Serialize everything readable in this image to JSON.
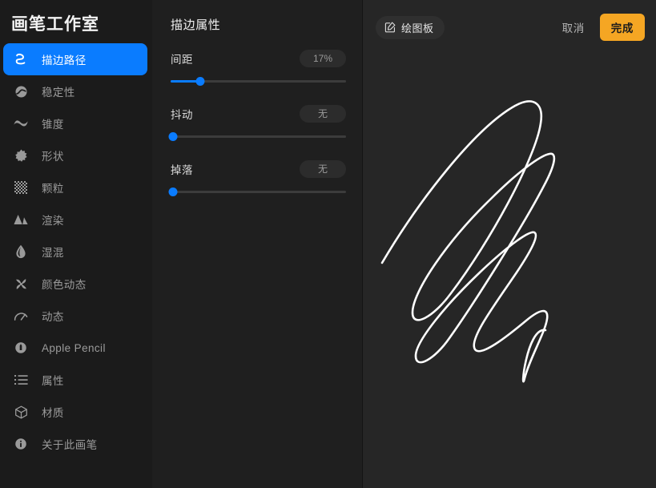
{
  "app": {
    "title": "画笔工作室"
  },
  "sidebar": {
    "items": [
      {
        "label": "描边路径",
        "icon": "stroke-path-icon",
        "selected": true
      },
      {
        "label": "稳定性",
        "icon": "stabilization-icon",
        "selected": false
      },
      {
        "label": "锥度",
        "icon": "taper-wave-icon",
        "selected": false
      },
      {
        "label": "形状",
        "icon": "shape-star-icon",
        "selected": false
      },
      {
        "label": "颗粒",
        "icon": "grain-dots-icon",
        "selected": false
      },
      {
        "label": "渲染",
        "icon": "render-mountains-icon",
        "selected": false
      },
      {
        "label": "湿混",
        "icon": "wet-mix-droplet-icon",
        "selected": false
      },
      {
        "label": "颜色动态",
        "icon": "color-dynamics-pinwheel-icon",
        "selected": false
      },
      {
        "label": "动态",
        "icon": "dynamics-gauge-icon",
        "selected": false
      },
      {
        "label": "Apple Pencil",
        "icon": "apple-pencil-icon",
        "selected": false
      },
      {
        "label": "属性",
        "icon": "properties-list-icon",
        "selected": false
      },
      {
        "label": "材质",
        "icon": "material-cube-icon",
        "selected": false
      },
      {
        "label": "关于此画笔",
        "icon": "info-circle-icon",
        "selected": false
      }
    ]
  },
  "properties": {
    "title": "描边属性",
    "sliders": [
      {
        "label": "间距",
        "value": "17%",
        "percent": 17
      },
      {
        "label": "抖动",
        "value": "无",
        "percent": 0
      },
      {
        "label": "掉落",
        "value": "无",
        "percent": 0
      }
    ]
  },
  "canvas": {
    "board_button": {
      "label": "绘图板",
      "icon": "compose-square-pencil-icon"
    },
    "cancel_label": "取消",
    "done_label": "完成",
    "stroke_color": "#ffffff",
    "background": "#262626"
  },
  "colors": {
    "accent_blue": "#0a7cff",
    "accent_orange": "#f5a623",
    "sidebar_bg": "#1b1b1b",
    "panel_bg": "#1f1f1f",
    "canvas_bg": "#262626"
  }
}
